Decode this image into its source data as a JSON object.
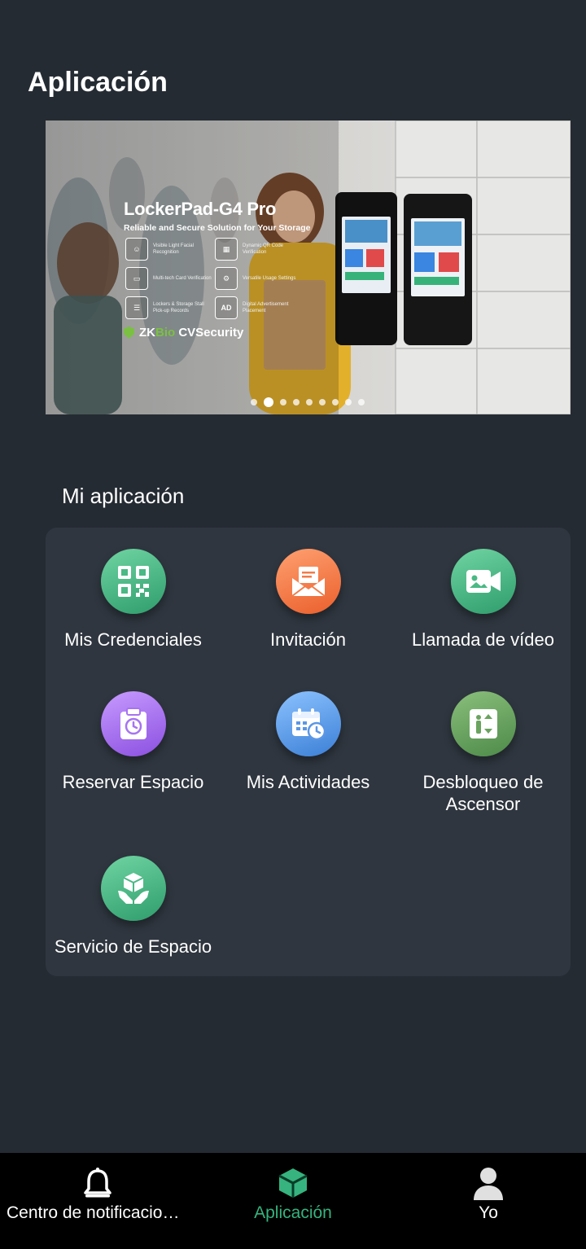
{
  "header": {
    "title": "Aplicación"
  },
  "banner": {
    "title": "LockerPad-G4 Pro",
    "subtitle": "Reliable and Secure Solution for Your Storage",
    "features": [
      {
        "icon": "face-scan-icon",
        "text": "Visible Light Facial Recognition"
      },
      {
        "icon": "qr-code-icon",
        "text": "Dynamic QR Code Verification"
      },
      {
        "icon": "card-icon",
        "text": "Multi-tech Card Verification"
      },
      {
        "icon": "user-settings-icon",
        "text": "Versatile Usage Settings"
      },
      {
        "icon": "storage-icon",
        "text": "Lockers & Storage Stall Pick-up Records"
      },
      {
        "icon": "ad-icon",
        "badge": "AD",
        "text": "Digital Advertisement Placement"
      }
    ],
    "brand_prefix": "ZK",
    "brand_mid": "Bio",
    "brand_suffix": " CVSecurity",
    "slide_count": 9,
    "active_slide": 1
  },
  "section": {
    "title": "Mi aplicación"
  },
  "apps": [
    {
      "label": "Mis Credenciales",
      "icon": "qr-code-icon",
      "color": "green"
    },
    {
      "label": "Invitación",
      "icon": "envelope-icon",
      "color": "orange"
    },
    {
      "label": "Llamada de vídeo",
      "icon": "video-call-icon",
      "color": "green"
    },
    {
      "label": "Reservar Espacio",
      "icon": "clipboard-clock-icon",
      "color": "purple"
    },
    {
      "label": "Mis Actividades",
      "icon": "calendar-clock-icon",
      "color": "blue"
    },
    {
      "label": "Desbloqueo de Ascensor",
      "icon": "elevator-icon",
      "color": "olive"
    },
    {
      "label": "Servicio de Espacio",
      "icon": "hand-box-icon",
      "color": "green"
    }
  ],
  "bottom_nav": [
    {
      "label": "Centro de notificaciones",
      "icon": "bell-icon",
      "active": false
    },
    {
      "label": "Aplicación",
      "icon": "cube-icon",
      "active": true
    },
    {
      "label": "Yo",
      "icon": "person-icon",
      "active": false
    }
  ],
  "colors": {
    "background": "#252b33",
    "card": "#2f363f",
    "nav_background": "#000000",
    "accent": "#36b37e"
  }
}
